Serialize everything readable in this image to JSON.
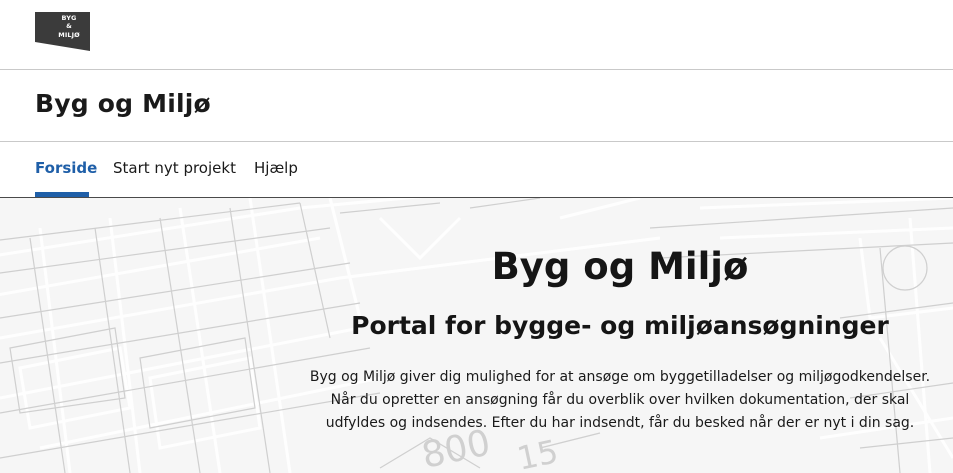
{
  "logo": {
    "lines": [
      "BYG",
      "&",
      "MILJØ"
    ],
    "color": "#3a3a3a"
  },
  "site": {
    "title": "Byg og Miljø"
  },
  "nav": {
    "items": [
      {
        "label": "Forside",
        "active": true
      },
      {
        "label": "Start nyt projekt",
        "active": false
      },
      {
        "label": "Hjælp",
        "active": false
      }
    ],
    "accent": "#1f5fa8"
  },
  "hero": {
    "title": "Byg og Miljø",
    "subtitle": "Portal for bygge- og miljøansøgninger",
    "lines": [
      "Byg og Miljø giver dig mulighed for at ansøge om byggetilladelser og miljøgodkendelser.",
      "Når du opretter en ansøgning får du overblik over hvilken dokumentation, der skal",
      "udfyldes og indsendes. Efter du har indsendt, får du besked når der er nyt i din sag."
    ]
  }
}
